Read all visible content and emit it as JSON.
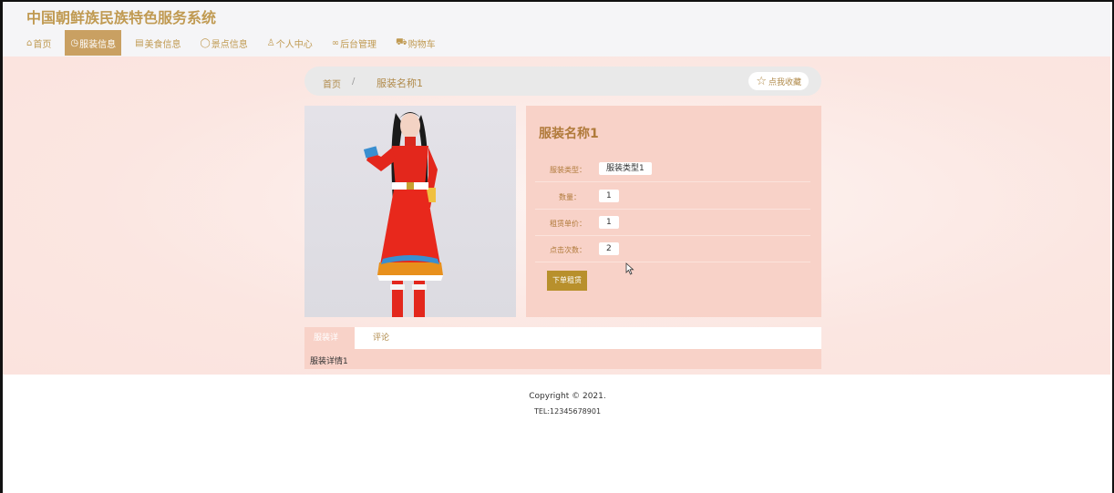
{
  "site": {
    "title": "中国朝鲜族民族特色服务系统"
  },
  "nav": {
    "items": [
      {
        "icon": "⌂",
        "label": "首页"
      },
      {
        "icon": "◷",
        "label": "服装信息"
      },
      {
        "icon": "▤",
        "label": "美食信息"
      },
      {
        "icon": "◯",
        "label": "景点信息"
      },
      {
        "icon": "♙",
        "label": "个人中心"
      },
      {
        "icon": "∞",
        "label": "后台管理"
      },
      {
        "icon": "⛟",
        "label": "购物车"
      }
    ],
    "active_index": 1
  },
  "breadcrumb": {
    "home": "首页",
    "separator": "/",
    "current": "服装名称1"
  },
  "favorite": {
    "label": "点我收藏"
  },
  "product": {
    "title": "服装名称1",
    "fields": [
      {
        "label": "服装类型：",
        "value": "服装类型1"
      },
      {
        "label": "数量：",
        "value": "1"
      },
      {
        "label": "租赁单价：",
        "value": "1"
      },
      {
        "label": "点击次数：",
        "value": "2"
      }
    ],
    "order_button": "下单租赁"
  },
  "tabs": {
    "items": [
      "服装详情",
      "评论"
    ],
    "content": "服装详情1"
  },
  "footer": {
    "copyright": "Copyright © 2021.",
    "tel": "TEL:12345678901"
  },
  "colors": {
    "accent": "#c9a062",
    "panel": "#f8d2c8",
    "brand_text": "#c09a52"
  }
}
